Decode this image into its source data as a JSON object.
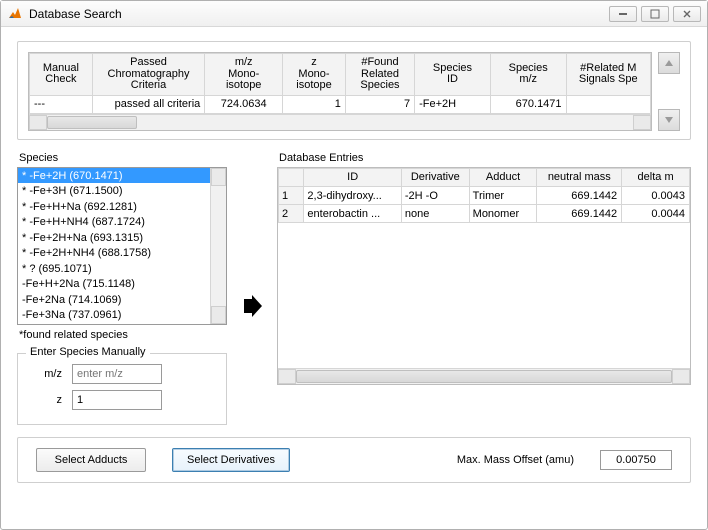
{
  "window": {
    "title": "Database Search"
  },
  "top_table": {
    "headers": [
      "Manual\nCheck",
      "Passed\nChromatography\nCriteria",
      "m/z\nMono-\nisotope",
      "z\nMono-\nisotope",
      "#Found\nRelated\nSpecies",
      "Species\nID",
      "Species\nm/z",
      "#Related M\nSignals Spe"
    ],
    "row": {
      "manual_check": "---",
      "passed": "passed all criteria",
      "mz": "724.0634",
      "z": "1",
      "nfound": "7",
      "species_id": "-Fe+2H",
      "species_mz": "670.1471",
      "nrel": ""
    }
  },
  "species": {
    "label": "Species",
    "items": [
      "* -Fe+2H (670.1471)",
      "* -Fe+3H (671.1500)",
      "* -Fe+H+Na (692.1281)",
      "* -Fe+H+NH4 (687.1724)",
      "* -Fe+2H+Na (693.1315)",
      "* -Fe+2H+NH4 (688.1758)",
      "* ? (695.1071)",
      "-Fe+H+2Na (715.1148)",
      "-Fe+2Na (714.1069)",
      "-Fe+3Na (737.0961)"
    ],
    "selected_index": 0,
    "footnote": "*found related species"
  },
  "manual": {
    "legend": "Enter Species Manually",
    "mz_label": "m/z",
    "mz_placeholder": "enter m/z",
    "z_label": "z",
    "z_value": "1"
  },
  "db": {
    "label": "Database Entries",
    "headers": [
      "ID",
      "Derivative",
      "Adduct",
      "neutral mass",
      "delta m"
    ],
    "rows": [
      {
        "n": "1",
        "id": "2,3-dihydroxy...",
        "deriv": "-2H -O",
        "adduct": "Trimer",
        "mass": "669.1442",
        "dm": "0.0043"
      },
      {
        "n": "2",
        "id": "enterobactin ...",
        "deriv": "none",
        "adduct": "Monomer",
        "mass": "669.1442",
        "dm": "0.0044"
      }
    ]
  },
  "bottom": {
    "adducts": "Select Adducts",
    "derivatives": "Select Derivatives",
    "offset_label": "Max. Mass Offset (amu)",
    "offset_value": "0.00750"
  }
}
